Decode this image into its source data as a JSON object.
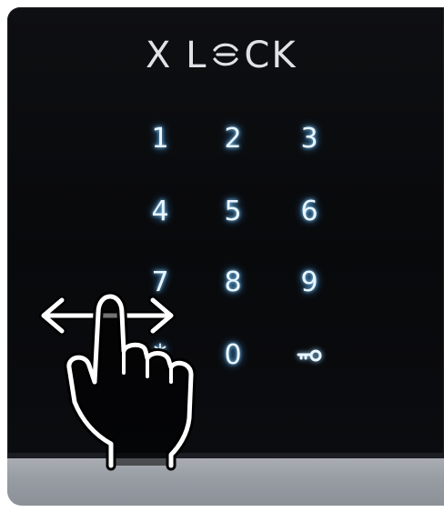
{
  "brand": {
    "text": "X LOCK",
    "first_part": "X L",
    "last_part": "CK"
  },
  "keypad": {
    "keys": [
      "1",
      "2",
      "3",
      "4",
      "5",
      "6",
      "7",
      "8",
      "9",
      "*",
      "0",
      "key"
    ],
    "glow_color": "#8fd3ff",
    "text_color": "#eaf6ff"
  },
  "gesture": {
    "icon": "swipe-left-right-hand-icon",
    "color": "#ffffff"
  },
  "colors": {
    "glass": "#0b0c0f",
    "metal": "#979ca3"
  }
}
